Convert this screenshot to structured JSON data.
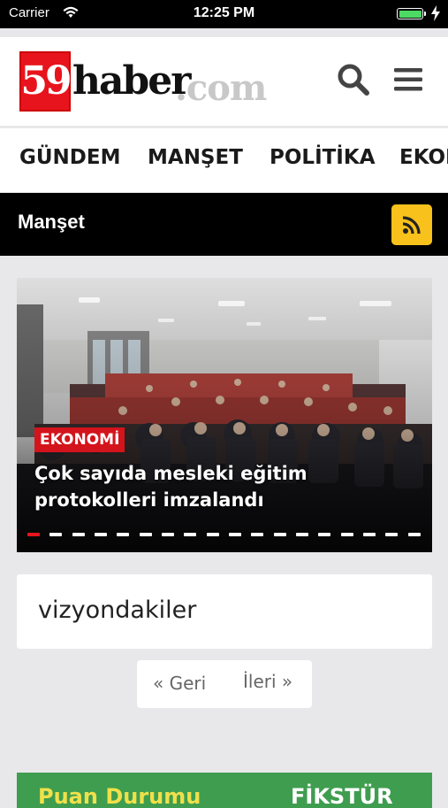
{
  "status_bar": {
    "carrier": "Carrier",
    "time": "12:25 PM",
    "battery_color": "#4cd964",
    "icons": [
      "wifi-icon",
      "battery-icon",
      "charging-bolt-icon"
    ]
  },
  "header": {
    "logo": {
      "number": "59",
      "word": "haber",
      "tld": ".com",
      "brand_red": "#e8141d"
    },
    "icons": [
      "search-icon",
      "menu-icon"
    ]
  },
  "categories": [
    "GÜNDEM",
    "MANŞET",
    "POLİTİKA",
    "EKONOMİ"
  ],
  "section": {
    "title": "Manşet",
    "rss_icon": "rss-icon",
    "rss_color": "#f8c11b"
  },
  "hero": {
    "category": "EKONOMİ",
    "title": "Çok sayıda mesleki eğitim protokolleri imzalandı",
    "slide_count": 18,
    "active_slide": 1,
    "accent": "#d4141c"
  },
  "vizyon": {
    "label": "vizyondakiler"
  },
  "pager": {
    "prev": "« Geri",
    "next": "İleri »"
  },
  "bottom_card": {
    "left_text": "Puan Durumu",
    "right_text": "FİKSTÜR",
    "color": "#3f9d4f"
  }
}
